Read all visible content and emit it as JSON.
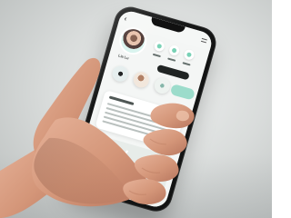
{
  "scene": {
    "description": "",
    "colors": {
      "background": "#d9dcdb",
      "phone": "#121313",
      "screen": "#f4f6f5",
      "accent": "#78d1b5",
      "hand": "#d89d83"
    }
  },
  "phone_ui": {
    "profile_name": "Lia Lu"
  }
}
